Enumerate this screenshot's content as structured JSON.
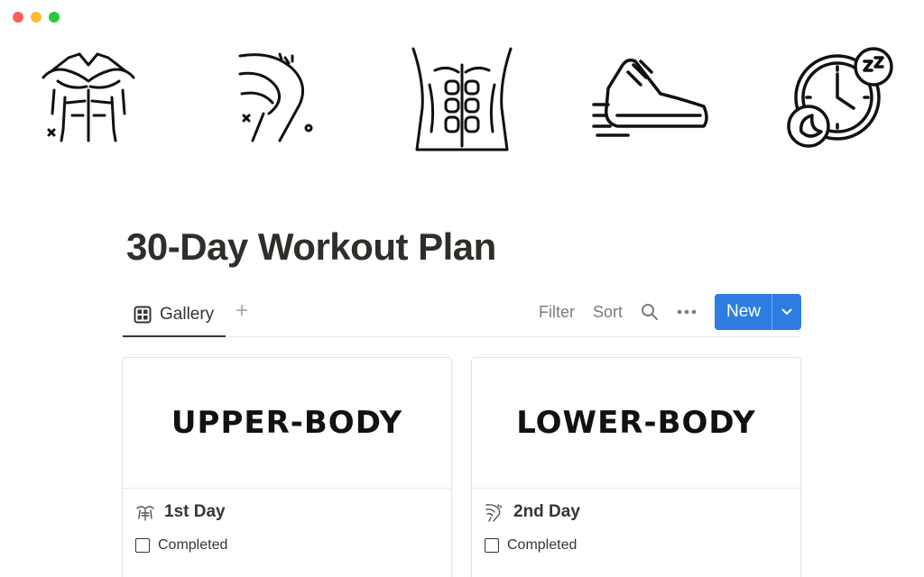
{
  "window": {
    "controls": [
      "close",
      "minimize",
      "zoom"
    ]
  },
  "hero_icons": [
    "muscular-torso-icon",
    "leg-flex-icon",
    "abs-icon",
    "running-shoe-icon",
    "sleep-clock-icon"
  ],
  "page": {
    "title": "30-Day Workout Plan"
  },
  "toolbar": {
    "view_tab": "Gallery",
    "add_view": "+",
    "filter": "Filter",
    "sort": "Sort",
    "new": "New"
  },
  "cards": [
    {
      "cover": "UPPER-BODY",
      "title": "1st Day",
      "property": "Completed",
      "icon": "torso-small-icon",
      "checked": false
    },
    {
      "cover": "LOWER-BODY",
      "title": "2nd Day",
      "property": "Completed",
      "icon": "leg-small-icon",
      "checked": false
    }
  ],
  "colors": {
    "accent": "#2d7de2",
    "text": "#37352f",
    "muted": "#7d7c78"
  }
}
